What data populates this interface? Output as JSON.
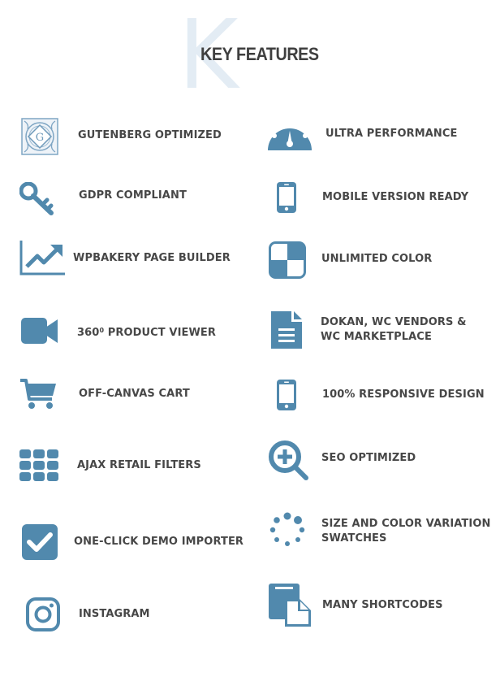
{
  "header": {
    "watermark_letter": "K",
    "title": "KEY FEATURES"
  },
  "colors": {
    "icon": "#5189ad",
    "text": "#474747",
    "watermark": "#e3ecf4"
  },
  "features": {
    "left": [
      {
        "icon": "gutenberg-logo-icon",
        "label": "GUTENBERG OPTIMIZED"
      },
      {
        "icon": "key-icon",
        "label": "GDPR COMPLIANT"
      },
      {
        "icon": "line-chart-icon",
        "label": "WPBAKERY PAGE BUILDER"
      },
      {
        "icon": "video-camera-icon",
        "label_main": "360",
        "label_sup": "0",
        "label_rest": " PRODUCT VIEWER"
      },
      {
        "icon": "shopping-cart-icon",
        "label": "OFF-CANVAS CART"
      },
      {
        "icon": "grid-icon",
        "label": "AJAX RETAIL FILTERS"
      },
      {
        "icon": "checkbox-icon",
        "label": "ONE-CLICK DEMO IMPORTER"
      },
      {
        "icon": "instagram-icon",
        "label": "INSTAGRAM"
      }
    ],
    "right": [
      {
        "icon": "speedometer-icon",
        "label": "ULTRA PERFORMANCE"
      },
      {
        "icon": "smartphone-icon",
        "label": "MOBILE VERSION READY"
      },
      {
        "icon": "color-swatch-icon",
        "label": "UNLIMITED COLOR"
      },
      {
        "icon": "document-icon",
        "label_line1": "DOKAN, WC VENDORS &",
        "label_line2": "WC MARKETPLACE"
      },
      {
        "icon": "smartphone-icon",
        "label": "100% RESPONSIVE DESIGN"
      },
      {
        "icon": "zoom-in-icon",
        "label": "SEO OPTIMIZED"
      },
      {
        "icon": "spinner-icon",
        "label_line1": "SIZE AND COLOR VARIATION",
        "label_line2": "SWATCHES"
      },
      {
        "icon": "copy-files-icon",
        "label": "MANY SHORTCODES"
      }
    ]
  }
}
